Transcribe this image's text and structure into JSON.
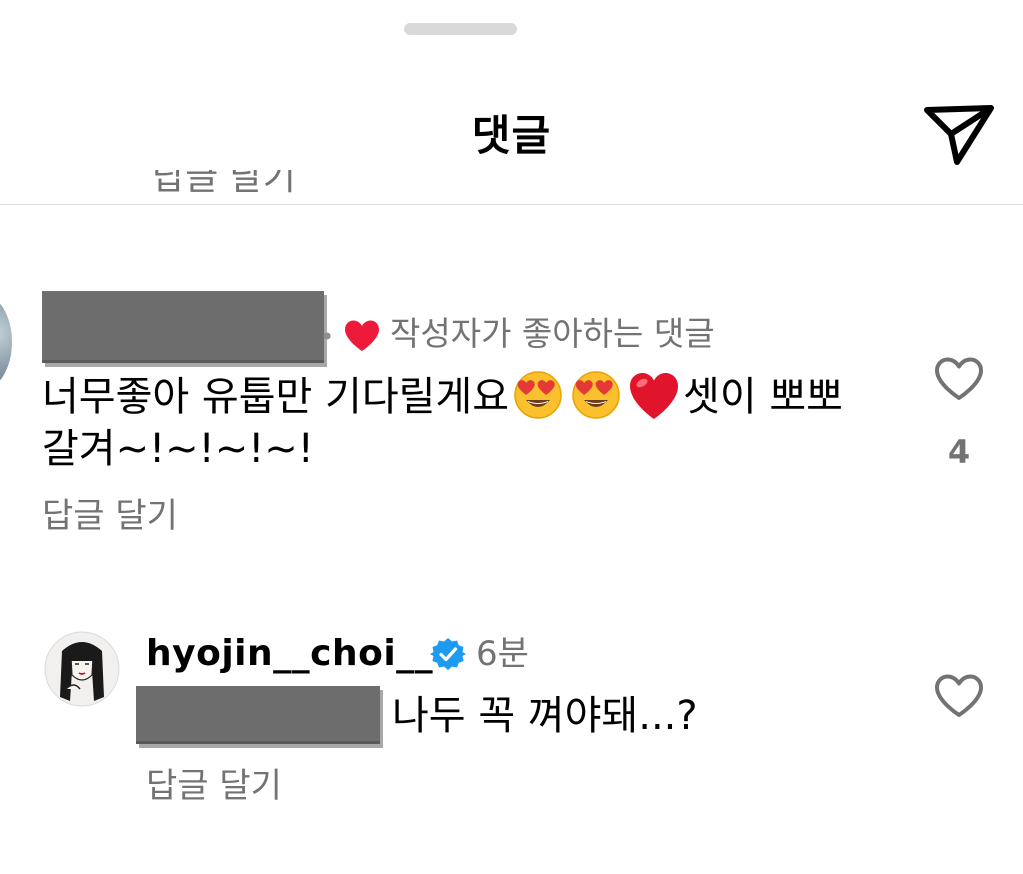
{
  "header": {
    "title": "댓글"
  },
  "partial_above": {
    "text": "답글 달기"
  },
  "comments": [
    {
      "liked_by_author_label": "작성자가 좋아하는 댓글",
      "text_line1": "너무좋아 유툽만 기다릴게요",
      "text_line1_tail": "셋이 뽀뽀",
      "text_line2": "갈겨~!~!~!~!",
      "reply_label": "답글 달기",
      "like_count": "4"
    },
    {
      "username": "hyojin__choi__",
      "verified": true,
      "time_ago": "6분",
      "text": "나두 꼭 껴야돼...?",
      "reply_label": "답글 달기"
    }
  ],
  "colors": {
    "secondary_text": "#737373",
    "divider": "#dbdbdb",
    "liked_heart": "#ed1a3b",
    "verified_badge": "#1d9bf0"
  },
  "icons": {
    "send": "paper-plane-icon",
    "like": "heart-outline-icon",
    "liked": "heart-filled-icon",
    "verified": "verified-badge-icon"
  }
}
